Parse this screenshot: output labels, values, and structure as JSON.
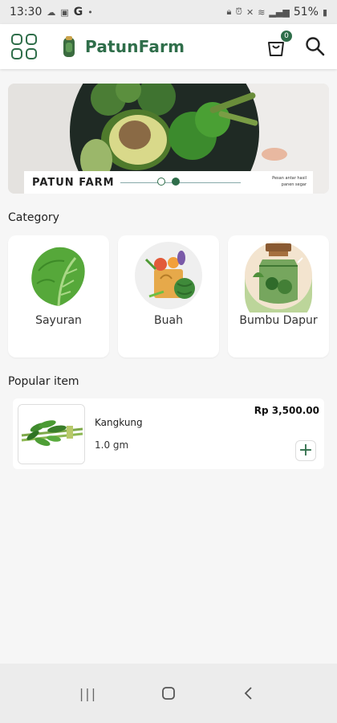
{
  "status": {
    "time": "13:30",
    "left_icons": [
      "cloud-icon",
      "image-icon",
      "google-icon",
      "dot-icon"
    ],
    "g_label": "G",
    "battery": "51%"
  },
  "appbar": {
    "brand": "PatunFarm",
    "cart_count": "0",
    "accent_color": "#2f6e4a"
  },
  "banner": {
    "title": "PATUN FARM",
    "tagline": "Pesan antar hasil panen segar",
    "slide_count": 2,
    "active_slide": 2
  },
  "category": {
    "title": "Category",
    "items": [
      {
        "label": "Sayuran",
        "icon": "lettuce-icon"
      },
      {
        "label": "Buah",
        "icon": "fruit-basket-icon"
      },
      {
        "label": "Bumbu Dapur",
        "icon": "spice-jar-icon"
      }
    ]
  },
  "popular": {
    "title": "Popular item",
    "items": [
      {
        "name": "Kangkung",
        "weight": "1.0 gm",
        "price": "Rp 3,500.00",
        "add_label": "+",
        "image": "kangkung-image"
      }
    ]
  },
  "navbar": {
    "recents": "|||",
    "home": "home-icon",
    "back": "back-icon"
  }
}
